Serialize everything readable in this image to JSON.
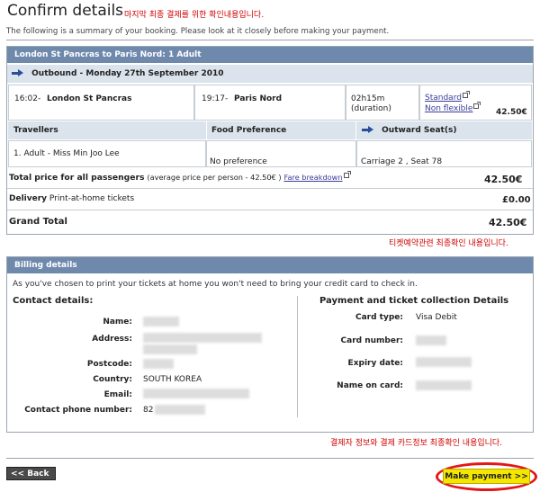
{
  "page": {
    "title": "Confirm details",
    "title_note": "마지막 최종 결제를 위한 확인내용입니다.",
    "intro": "The following is a summary of your booking. Please look at it closely before making your payment."
  },
  "booking": {
    "header": "London St Pancras to Paris Nord: 1 Adult",
    "outbound_label": "Outbound - Monday 27th September 2010",
    "depart_time": "16:02",
    "depart_station": "London St Pancras",
    "arrive_time": "19:17",
    "arrive_station": "Paris Nord",
    "duration": "02h15m",
    "duration_label": "(duration)",
    "class_link": "Standard",
    "flex_link": "Non flexible",
    "fare": "42.50€",
    "travellers_head": "Travellers",
    "food_head": "Food Preference",
    "seat_head": "Outward Seat(s)",
    "traveller": "1. Adult - Miss Min Joo Lee",
    "food": "No preference",
    "seat": "Carriage  2 , Seat  78",
    "total_label": "Total price for all passengers",
    "total_avg": "(average price per person - 42.50€ )",
    "fare_breakdown_link": "Fare breakdown",
    "total_value": "42.50€",
    "delivery_label": "Delivery",
    "delivery_value": "Print-at-home tickets",
    "delivery_price": "£0.00",
    "grand_label": "Grand Total",
    "grand_value": "42.50€",
    "note": "티켓예약관련 최종확인 내용입니다."
  },
  "billing": {
    "header": "Billing details",
    "intro": "As you've chosen to print your tickets at home you won't need to bring your credit card to check in.",
    "contact_title": "Contact details:",
    "name_label": "Name:",
    "address_label": "Address:",
    "postcode_label": "Postcode:",
    "country_label": "Country:",
    "country_value": "SOUTH KOREA",
    "email_label": "Email:",
    "phone_label": "Contact phone number:",
    "phone_prefix": "82",
    "payment_title": "Payment and ticket collection Details",
    "card_type_label": "Card type:",
    "card_type_value": "Visa Debit",
    "card_number_label": "Card number:",
    "expiry_label": "Expiry date:",
    "name_on_card_label": "Name on card:",
    "note": "결제자 정보와 결제 카드정보 최종확인 내용입니다."
  },
  "actions": {
    "back": "<< Back",
    "pay": "Make payment >>"
  },
  "colors": {
    "panel_header": "#6f89ad",
    "subheader": "#dbe3ec",
    "pay_button": "#f5e600",
    "annotation": "#d10000"
  }
}
